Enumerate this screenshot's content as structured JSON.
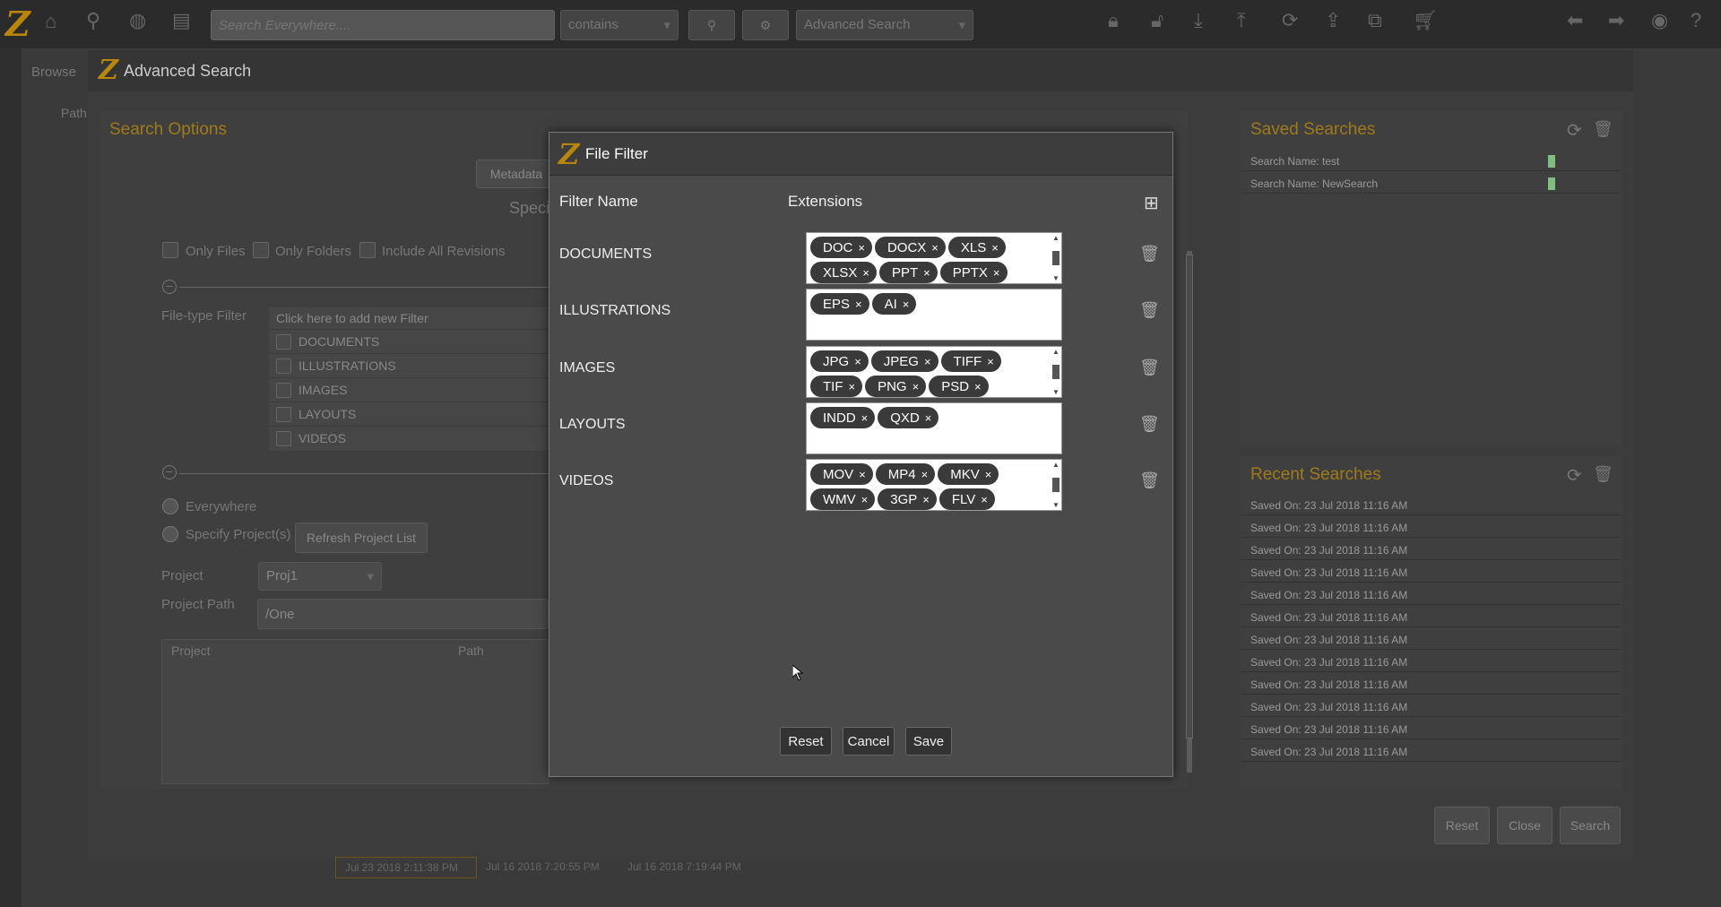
{
  "topbar": {
    "logo": "Z",
    "search_placeholder": "Search Everywhere....",
    "match_mode": "contains",
    "search_type": "Advanced Search"
  },
  "browse_tab": "Browse",
  "path_label": "Path",
  "advanced_search": {
    "title": "Advanced Search",
    "search_options_title": "Search Options",
    "metadata_tab": "Metadata",
    "spec_text": "Speci",
    "only_files": "Only Files",
    "only_folders": "Only Folders",
    "include_all_revisions": "Include All Revisions",
    "file_type_filter_label": "File-type Filter",
    "add_filter_text": "Click here to add new Filter",
    "filters": [
      "DOCUMENTS",
      "ILLUSTRATIONS",
      "IMAGES",
      "LAYOUTS",
      "VIDEOS"
    ],
    "everywhere": "Everywhere",
    "specify_projects": "Specify Project(s)",
    "refresh_project_list": "Refresh Project List",
    "project_label": "Project",
    "project_value": "Proj1",
    "project_path_label": "Project Path",
    "project_path_value": "/One",
    "table_headers": [
      "Project",
      "Path"
    ],
    "reset": "Reset",
    "close": "Close",
    "search": "Search"
  },
  "saved_searches": {
    "title": "Saved Searches",
    "items": [
      "Search Name: test",
      "Search Name: NewSearch"
    ]
  },
  "recent_searches": {
    "title": "Recent Searches",
    "items": [
      "Saved On: 23 Jul 2018 11:16 AM",
      "Saved On: 23 Jul 2018 11:16 AM",
      "Saved On: 23 Jul 2018 11:16 AM",
      "Saved On: 23 Jul 2018 11:16 AM",
      "Saved On: 23 Jul 2018 11:16 AM",
      "Saved On: 23 Jul 2018 11:16 AM",
      "Saved On: 23 Jul 2018 11:16 AM",
      "Saved On: 23 Jul 2018 11:16 AM",
      "Saved On: 23 Jul 2018 11:16 AM",
      "Saved On: 23 Jul 2018 11:16 AM",
      "Saved On: 23 Jul 2018 11:16 AM",
      "Saved On: 23 Jul 2018 11:16 AM"
    ]
  },
  "bottom_dates": [
    "Jul 23 2018 2:11:38 PM",
    "Jul 16 2018 7:20:55 PM",
    "Jul 16 2018 7:19:44 PM"
  ],
  "file_filter": {
    "title": "File Filter",
    "col_filter_name": "Filter Name",
    "col_extensions": "Extensions",
    "rows": [
      {
        "name": "DOCUMENTS",
        "extensions": [
          "DOC",
          "DOCX",
          "XLS",
          "XLSX",
          "PPT",
          "PPTX"
        ]
      },
      {
        "name": "ILLUSTRATIONS",
        "extensions": [
          "EPS",
          "AI"
        ]
      },
      {
        "name": "IMAGES",
        "extensions": [
          "JPG",
          "JPEG",
          "TIFF",
          "TIF",
          "PNG",
          "PSD"
        ]
      },
      {
        "name": "LAYOUTS",
        "extensions": [
          "INDD",
          "QXD"
        ]
      },
      {
        "name": "VIDEOS",
        "extensions": [
          "MOV",
          "MP4",
          "MKV",
          "WMV",
          "3GP",
          "FLV"
        ]
      }
    ],
    "reset": "Reset",
    "cancel": "Cancel",
    "save": "Save"
  }
}
